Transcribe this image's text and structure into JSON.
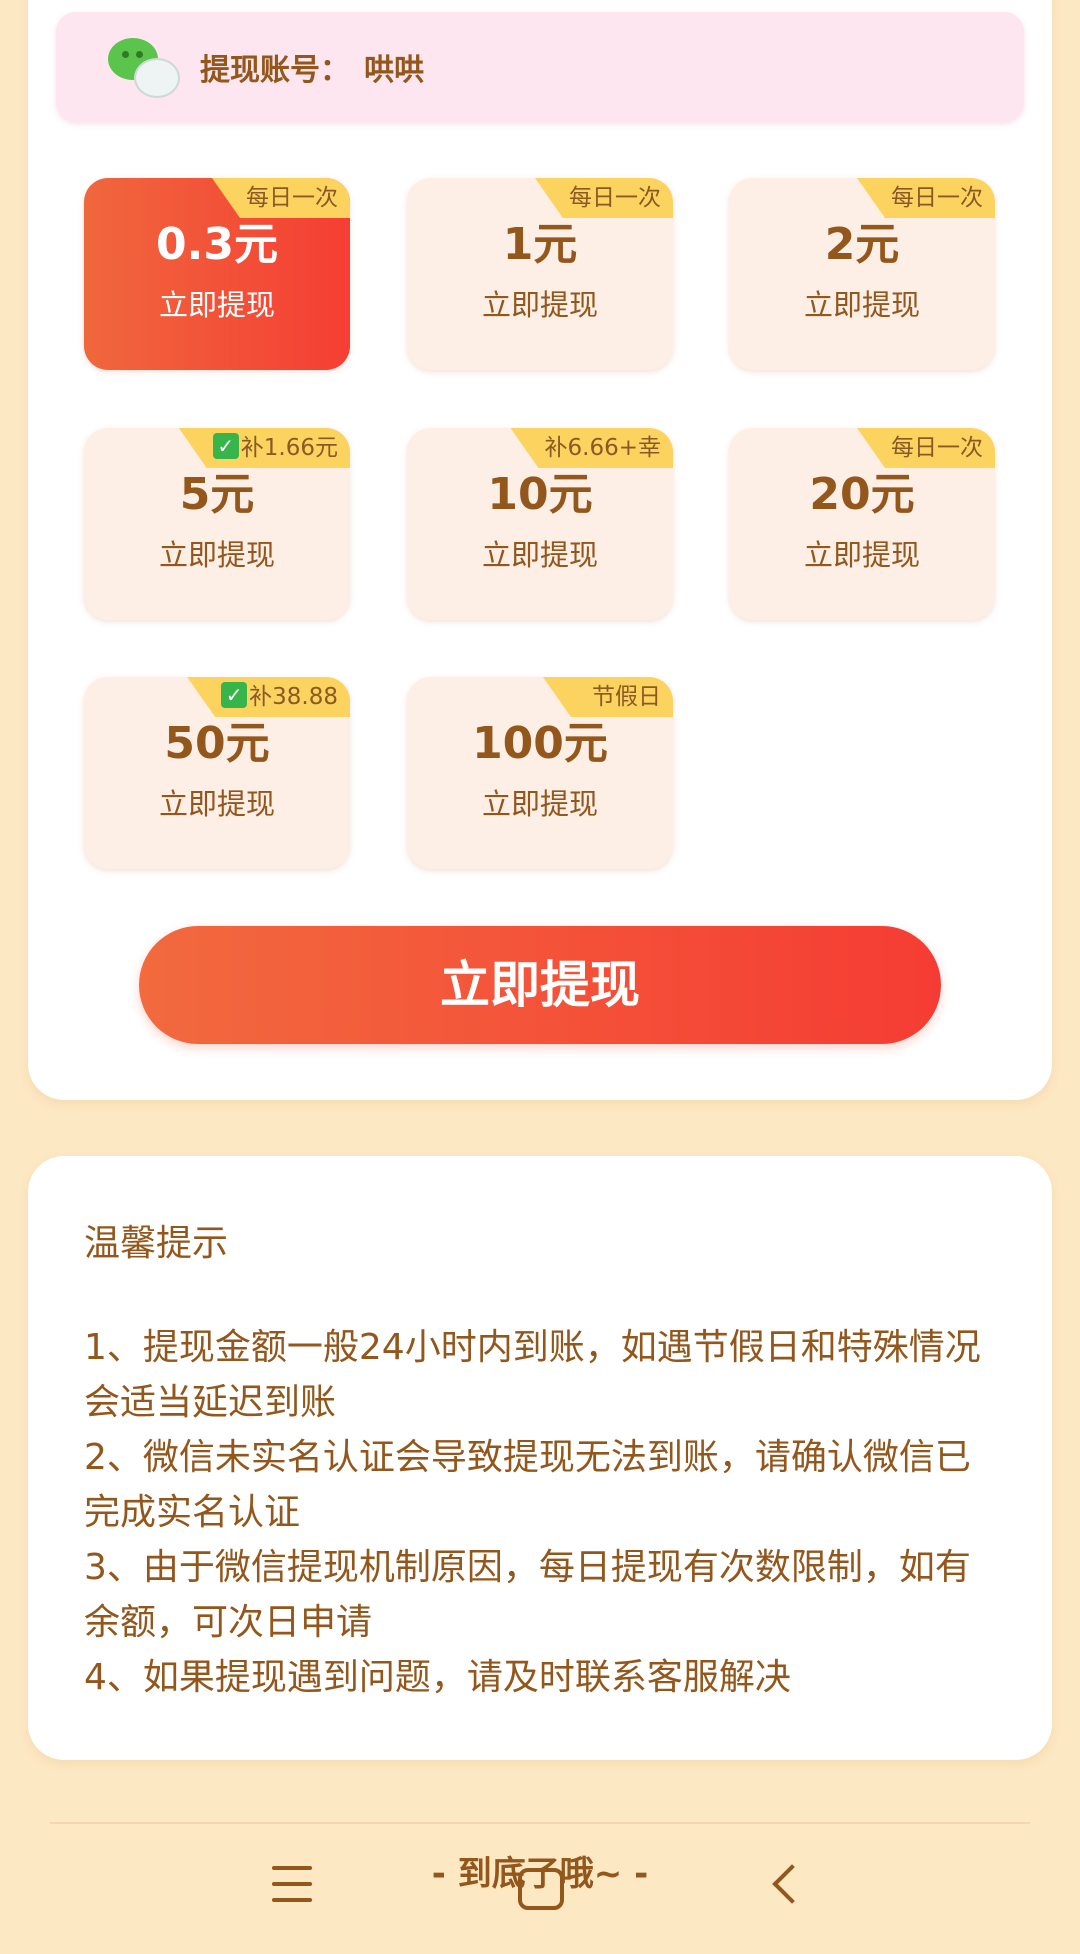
{
  "account": {
    "label": "提现账号：",
    "value": "哄哄",
    "icon": "wechat-icon"
  },
  "options": [
    {
      "amount": "0.3元",
      "action": "立即提现",
      "badge": "每日一次",
      "badge_check": false,
      "selected": true
    },
    {
      "amount": "1元",
      "action": "立即提现",
      "badge": "每日一次",
      "badge_check": false,
      "selected": false
    },
    {
      "amount": "2元",
      "action": "立即提现",
      "badge": "每日一次",
      "badge_check": false,
      "selected": false
    },
    {
      "amount": "5元",
      "action": "立即提现",
      "badge": "补1.66元",
      "badge_check": true,
      "selected": false
    },
    {
      "amount": "10元",
      "action": "立即提现",
      "badge": "补6.66+幸",
      "badge_check": false,
      "selected": false
    },
    {
      "amount": "20元",
      "action": "立即提现",
      "badge": "每日一次",
      "badge_check": false,
      "selected": false
    },
    {
      "amount": "50元",
      "action": "立即提现",
      "badge": "补38.88",
      "badge_check": true,
      "selected": false
    },
    {
      "amount": "100元",
      "action": "立即提现",
      "badge": "节假日",
      "badge_check": false,
      "selected": false
    }
  ],
  "withdraw_button": {
    "label": "立即提现"
  },
  "tips": {
    "title": "温馨提示",
    "items": [
      "1、提现金额一般24小时内到账，如遇节假日和特殊情况会适当延迟到账",
      "2、微信未实名认证会导致提现无法到账，请确认微信已完成实名认证",
      "3、由于微信提现机制原因，每日提现有次数限制，如有余额，可次日申请",
      "4、如果提现遇到问题，请及时联系客服解决"
    ]
  },
  "footer": {
    "end_text": "- 到底了哦~ -"
  },
  "colors": {
    "background": "#fde8c4",
    "text_brown": "#93561b",
    "accent_red": "#f53e34",
    "accent_orange": "#f0673d",
    "badge_yellow": "#fcd35f",
    "tile_bg": "#fdeee6"
  },
  "nav": {
    "menu_icon": "menu-icon",
    "home_icon": "home-icon",
    "back_icon": "back-icon"
  }
}
